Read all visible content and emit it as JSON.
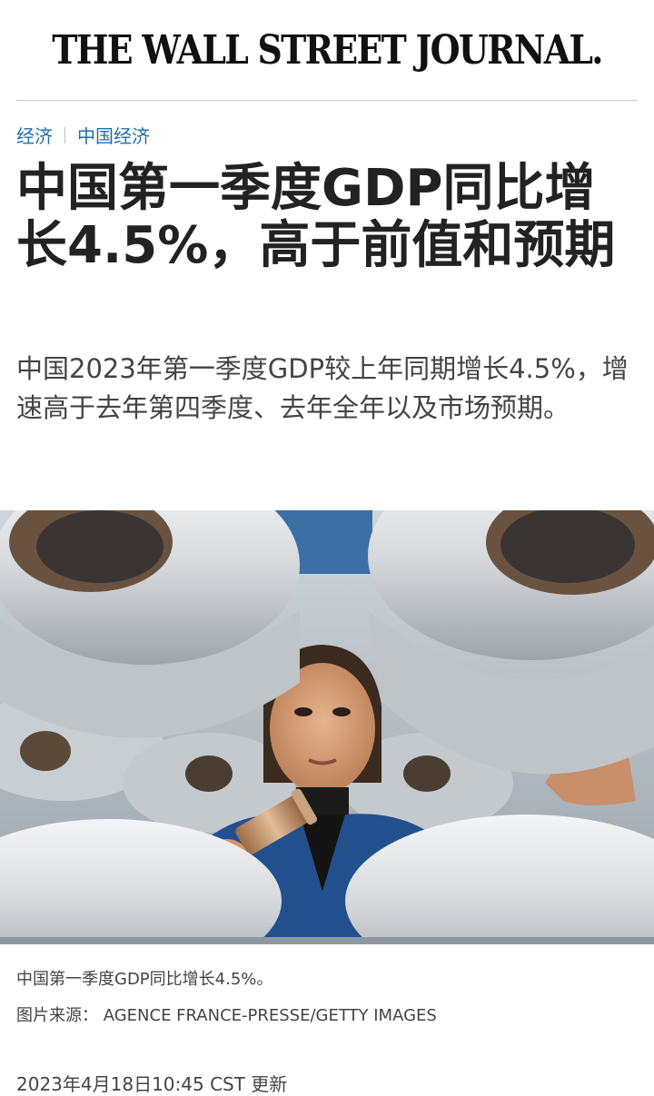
{
  "masthead": {
    "title": "THE WALL STREET JOURNAL."
  },
  "breadcrumb": {
    "section": "经济",
    "subsection": "中国经济"
  },
  "article": {
    "headline": "中国第一季度GDP同比增长4.5%，高于前值和预期",
    "dek": "中国2023年第一季度GDP较上年同期增长4.5%，增速高于去年第四季度、去年全年以及市场预期。",
    "photo_caption": "中国第一季度GDP同比增长4.5%。",
    "photo_credit": "图片来源：  AGENCE FRANCE-PRESSE/GETTY IMAGES",
    "timestamp": "2023年4月18日10:45 CST 更新"
  },
  "colors": {
    "link": "#1f6fa8",
    "text": "#222222",
    "secondary_text": "#444444",
    "rule": "#cccccc"
  }
}
